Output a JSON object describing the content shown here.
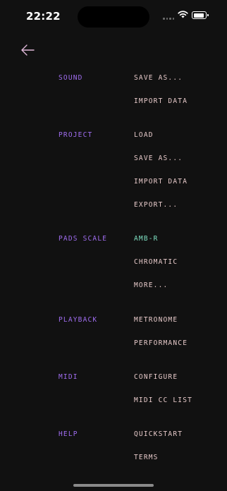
{
  "status_bar": {
    "time": "22:22"
  },
  "icons": {
    "back": "arrow-left-icon",
    "wifi": "wifi-icon",
    "battery": "battery-icon",
    "signal": "signal-icon"
  },
  "colors": {
    "background": "#111111",
    "section": "#a06df0",
    "item": "#e6c9c9",
    "active_item": "#7ee0c2",
    "back_arrow": "#e0b8d8"
  },
  "sections": [
    {
      "label": "SOUND",
      "items": [
        {
          "label": "SAVE AS..."
        },
        {
          "label": "IMPORT DATA"
        }
      ]
    },
    {
      "label": "PROJECT",
      "items": [
        {
          "label": "LOAD"
        },
        {
          "label": "SAVE AS..."
        },
        {
          "label": "IMPORT DATA"
        },
        {
          "label": "EXPORT..."
        }
      ]
    },
    {
      "label": "PADS SCALE",
      "items": [
        {
          "label": "AMB-R",
          "active": true
        },
        {
          "label": "CHROMATIC"
        },
        {
          "label": "MORE..."
        }
      ]
    },
    {
      "label": "PLAYBACK",
      "items": [
        {
          "label": "METRONOME"
        },
        {
          "label": "PERFORMANCE"
        }
      ]
    },
    {
      "label": "MIDI",
      "items": [
        {
          "label": "CONFIGURE"
        },
        {
          "label": "MIDI CC LIST"
        }
      ]
    },
    {
      "label": "HELP",
      "items": [
        {
          "label": "QUICKSTART"
        },
        {
          "label": "TERMS"
        }
      ]
    }
  ]
}
